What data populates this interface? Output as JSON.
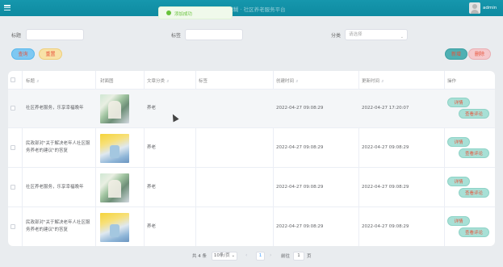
{
  "header": {
    "title": "图片模糊 · 社区养老服务平台",
    "username": "admin"
  },
  "toast": {
    "message": "添加成功"
  },
  "filters": {
    "title_label": "标题",
    "tag_label": "标签",
    "category_label": "分类",
    "category_placeholder": "请选择",
    "title_value": "",
    "tag_value": ""
  },
  "buttons": {
    "search": "查询",
    "reset": "重置",
    "add": "新增",
    "delete": "删除"
  },
  "table": {
    "headers": [
      "标题",
      "封面图",
      "文章分类",
      "标签",
      "创建时间",
      "更新时间",
      "操作"
    ],
    "rows": [
      {
        "title": "社区养老服务，乐享幸福晚年",
        "category": "养老",
        "tag": "",
        "created": "2022-04-27 09:08:29",
        "updated": "2022-04-27 17:20:07",
        "detail": "详情",
        "comments": "查看评论"
      },
      {
        "title": "民政部对\"关于解决老年人社区服务养老的建议\"的答复",
        "category": "养老",
        "tag": "",
        "created": "2022-04-27 09:08:29",
        "updated": "2022-04-27 09:08:29",
        "detail": "详情",
        "comments": "查看评论"
      },
      {
        "title": "社区养老服务，乐享幸福晚年",
        "category": "养老",
        "tag": "",
        "created": "2022-04-27 09:08:29",
        "updated": "2022-04-27 09:08:29",
        "detail": "详情",
        "comments": "查看评论"
      },
      {
        "title": "民政部对\"关于解决老年人社区服务养老的建议\"的答复",
        "category": "养老",
        "tag": "",
        "created": "2022-04-27 09:08:29",
        "updated": "2022-04-27 09:08:29",
        "detail": "详情",
        "comments": "查看评论"
      }
    ]
  },
  "pagination": {
    "total": "共 4 条",
    "page_size": "10条/页",
    "current_page": "1",
    "goto_label": "前往",
    "goto_value": "1",
    "page_suffix": "页"
  }
}
